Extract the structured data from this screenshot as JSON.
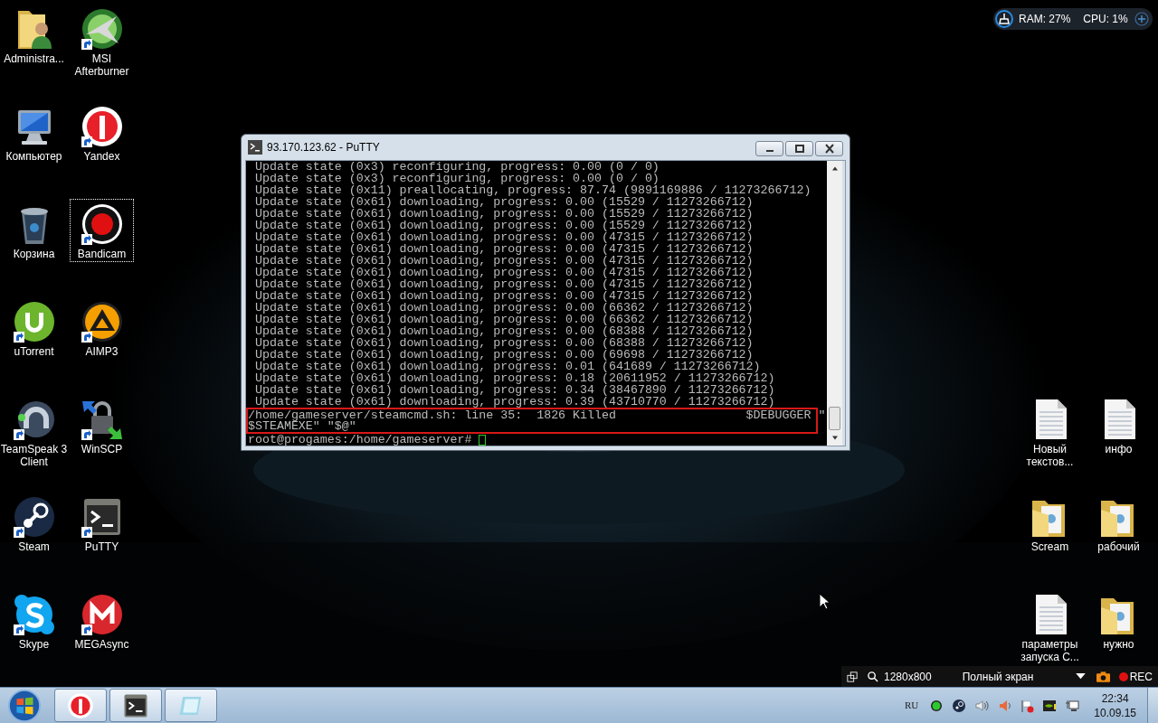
{
  "system_monitor": {
    "ram": "RAM: 27%",
    "cpu": "CPU: 1%"
  },
  "desktop_icons_left": [
    {
      "label": "Administra...",
      "kind": "user-folder",
      "shortcut": false,
      "selected": false
    },
    {
      "label": "MSI Afterburner",
      "kind": "msi",
      "shortcut": true,
      "selected": false
    },
    {
      "label": "Компьютер",
      "kind": "computer",
      "shortcut": false,
      "selected": false
    },
    {
      "label": "Yandex",
      "kind": "yandex",
      "shortcut": true,
      "selected": false
    },
    {
      "label": "Корзина",
      "kind": "trash",
      "shortcut": false,
      "selected": false
    },
    {
      "label": "Bandicam",
      "kind": "bandicam",
      "shortcut": true,
      "selected": true
    },
    {
      "label": "uTorrent",
      "kind": "utorrent",
      "shortcut": true,
      "selected": false
    },
    {
      "label": "AIMP3",
      "kind": "aimp",
      "shortcut": true,
      "selected": false
    },
    {
      "label": "TeamSpeak 3 Client",
      "kind": "teamspeak",
      "shortcut": true,
      "selected": false
    },
    {
      "label": "WinSCP",
      "kind": "winscp",
      "shortcut": true,
      "selected": false
    },
    {
      "label": "Steam",
      "kind": "steam",
      "shortcut": true,
      "selected": false
    },
    {
      "label": "PuTTY",
      "kind": "putty",
      "shortcut": true,
      "selected": false
    },
    {
      "label": "Skype",
      "kind": "skype",
      "shortcut": true,
      "selected": false
    },
    {
      "label": "MEGAsync",
      "kind": "mega",
      "shortcut": true,
      "selected": false
    }
  ],
  "desktop_icons_right": [
    {
      "label": "Новый текстов...",
      "kind": "document",
      "shortcut": false,
      "selected": false
    },
    {
      "label": "инфо",
      "kind": "document",
      "shortcut": false,
      "selected": false
    },
    {
      "label": "Scream",
      "kind": "folder",
      "shortcut": false,
      "selected": false
    },
    {
      "label": "рабочий",
      "kind": "folder",
      "shortcut": false,
      "selected": false
    },
    {
      "label": "параметры запуска С...",
      "kind": "document",
      "shortcut": false,
      "selected": false
    },
    {
      "label": "нужно",
      "kind": "folder",
      "shortcut": false,
      "selected": false
    }
  ],
  "putty": {
    "title": "93.170.123.62 - PuTTY",
    "lines": [
      "Update state (0x3) reconfiguring, progress: 0.00 (0 / 0)",
      "Update state (0x3) reconfiguring, progress: 0.00 (0 / 0)",
      "Update state (0x11) preallocating, progress: 87.74 (9891169886 / 11273266712)",
      "Update state (0x61) downloading, progress: 0.00 (15529 / 11273266712)",
      "Update state (0x61) downloading, progress: 0.00 (15529 / 11273266712)",
      "Update state (0x61) downloading, progress: 0.00 (15529 / 11273266712)",
      "Update state (0x61) downloading, progress: 0.00 (47315 / 11273266712)",
      "Update state (0x61) downloading, progress: 0.00 (47315 / 11273266712)",
      "Update state (0x61) downloading, progress: 0.00 (47315 / 11273266712)",
      "Update state (0x61) downloading, progress: 0.00 (47315 / 11273266712)",
      "Update state (0x61) downloading, progress: 0.00 (47315 / 11273266712)",
      "Update state (0x61) downloading, progress: 0.00 (47315 / 11273266712)",
      "Update state (0x61) downloading, progress: 0.00 (66362 / 11273266712)",
      "Update state (0x61) downloading, progress: 0.00 (66362 / 11273266712)",
      "Update state (0x61) downloading, progress: 0.00 (68388 / 11273266712)",
      "Update state (0x61) downloading, progress: 0.00 (68388 / 11273266712)",
      "Update state (0x61) downloading, progress: 0.00 (69698 / 11273266712)",
      "Update state (0x61) downloading, progress: 0.01 (641689 / 11273266712)",
      "Update state (0x61) downloading, progress: 0.18 (20611952 / 11273266712)",
      "Update state (0x61) downloading, progress: 0.34 (38467890 / 11273266712)",
      "Update state (0x61) downloading, progress: 0.39 (43710770 / 11273266712)"
    ],
    "highlighted_lines": [
      "/home/gameserver/steamcmd.sh: line 35:  1826 Killed                  $DEBUGGER \"",
      "$STEAMEXE\" \"$@\""
    ],
    "prompt": "root@progames:/home/gameserver# "
  },
  "recorder_bar": {
    "resolution": "1280x800",
    "mode": "Полный экран",
    "rec": "REC"
  },
  "taskbar": {
    "apps": [
      {
        "kind": "yandex"
      },
      {
        "kind": "putty"
      },
      {
        "kind": "notepad"
      }
    ],
    "language": "RU",
    "time": "22:34",
    "date": "10.09.15"
  }
}
